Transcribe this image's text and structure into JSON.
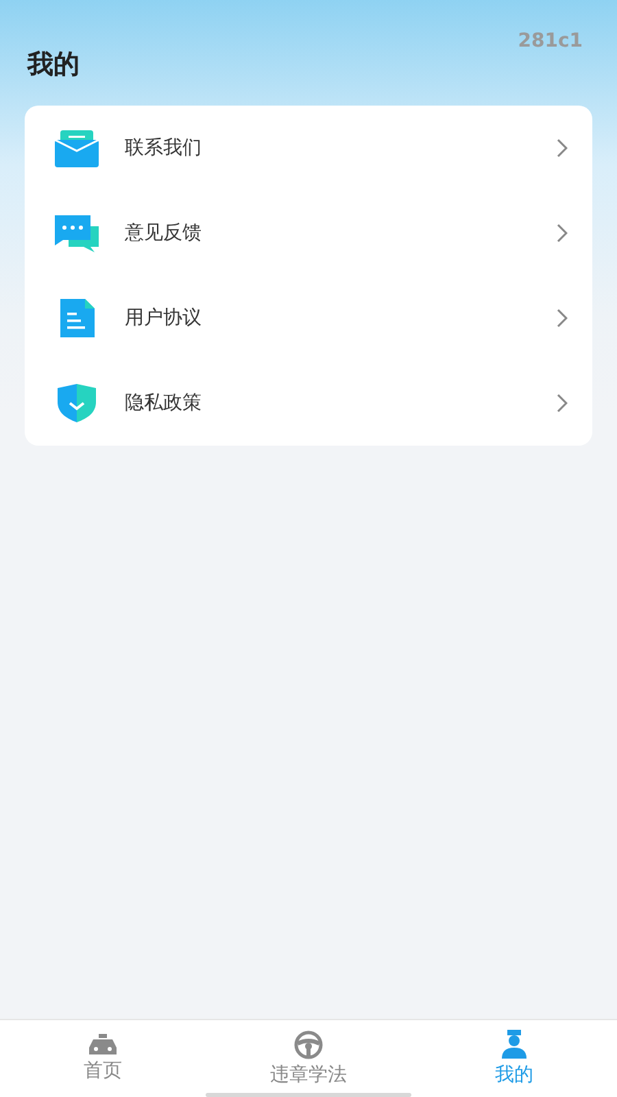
{
  "header": {
    "title": "我的",
    "version": "281c1"
  },
  "menu": [
    {
      "label": "联系我们"
    },
    {
      "label": "意见反馈"
    },
    {
      "label": "用户协议"
    },
    {
      "label": "隐私政策"
    }
  ],
  "tabs": [
    {
      "label": "首页",
      "selected": false
    },
    {
      "label": "违章学法",
      "selected": false
    },
    {
      "label": "我的",
      "selected": true
    }
  ]
}
